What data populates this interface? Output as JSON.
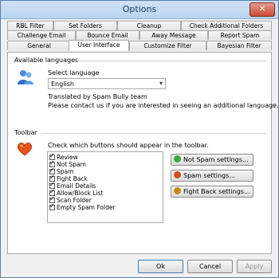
{
  "window": {
    "title": "Options",
    "close_glyph": "✕"
  },
  "tabs_row1": [
    "RBL Filter",
    "Set Folders",
    "Cleanup",
    "Check Additional Folders"
  ],
  "tabs_row2": [
    "Challenge Email",
    "Bounce Email",
    "Away Message",
    "Report Spam"
  ],
  "tabs_row3": [
    "General",
    "User Interface",
    "Customize Filter",
    "Bayesian Filter"
  ],
  "active_tab": "User Interface",
  "languages": {
    "section_title": "Available languages",
    "icon": "people-icon",
    "select_label": "Select language",
    "selected": "English",
    "translated_by": "Translated by Spam Bully team",
    "contact_note": "Please contact us if you are interested in seeing an additional language."
  },
  "toolbar": {
    "section_title": "Toolbar",
    "icon": "heart-icon",
    "instruction": "Check which buttons should appear in the toolbar.",
    "items": [
      {
        "label": "Review",
        "checked": true
      },
      {
        "label": "Not Spam",
        "checked": true
      },
      {
        "label": "Spam",
        "checked": true
      },
      {
        "label": "Fight Back",
        "checked": true
      },
      {
        "label": "Email Details",
        "checked": true
      },
      {
        "label": "Allow/Block List",
        "checked": true
      },
      {
        "label": "Scan Folder",
        "checked": true
      },
      {
        "label": "Empty Spam Folder",
        "checked": true
      }
    ],
    "buttons": [
      {
        "label": "Not Spam settings...",
        "icon_color": "#3aa83a"
      },
      {
        "label": "Spam settings...",
        "icon_color": "#d44a1c"
      },
      {
        "label": "Fight Back settings...",
        "icon_color": "#c8891c"
      }
    ]
  },
  "footer": {
    "ok": "Ok",
    "cancel": "Cancel",
    "apply": "Apply"
  }
}
